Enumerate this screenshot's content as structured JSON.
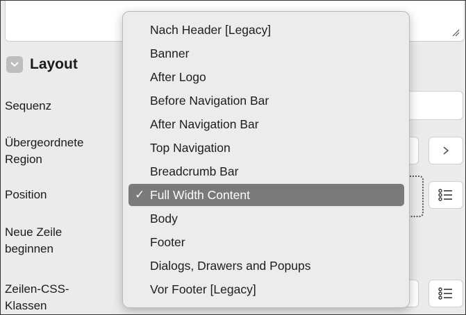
{
  "section": {
    "title": "Layout"
  },
  "fields": {
    "sequenz": "Sequenz",
    "region_line1": "Übergeordnete",
    "region_line2": "Region",
    "position": "Position",
    "neue_line1": "Neue Zeile",
    "neue_line2": "beginnen",
    "zeilen_line1": "Zeilen-CSS-",
    "zeilen_line2": "Klassen"
  },
  "menu": {
    "items": [
      "Nach Header [Legacy]",
      "Banner",
      "After Logo",
      "Before Navigation Bar",
      "After Navigation Bar",
      "Top Navigation",
      "Breadcrumb Bar",
      "Full Width Content",
      "Body",
      "Footer",
      "Dialogs, Drawers and Popups",
      "Vor Footer [Legacy]"
    ],
    "selected": "Full Width Content",
    "check": "✓"
  },
  "icons": {
    "section_toggle": "chevron-down-icon",
    "region_button": "chevron-right-icon",
    "position_button": "list-icon",
    "css_button": "list-icon",
    "resize": "resize-grip-icon"
  }
}
